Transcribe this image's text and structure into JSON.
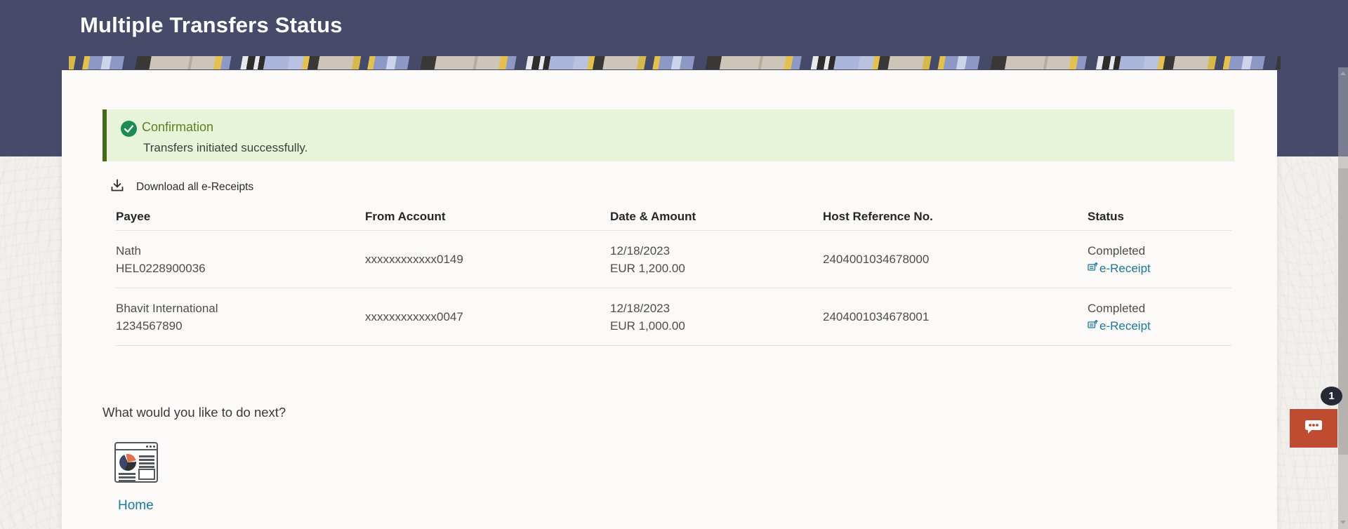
{
  "header": {
    "title": "Multiple Transfers Status"
  },
  "confirmation": {
    "title": "Confirmation",
    "message": "Transfers initiated successfully."
  },
  "actions": {
    "download_all_label": "Download all e-Receipts"
  },
  "table": {
    "columns": [
      "Payee",
      "From Account",
      "Date & Amount",
      "Host Reference No.",
      "Status"
    ],
    "rows": [
      {
        "payee_name": "Nath",
        "payee_id": "HEL0228900036",
        "from_account": "xxxxxxxxxxxx0149",
        "date": "12/18/2023",
        "amount": "EUR 1,200.00",
        "host_reference_no": "2404001034678000",
        "status": "Completed",
        "receipt_link": "e-Receipt"
      },
      {
        "payee_name": "Bhavit International",
        "payee_id": "1234567890",
        "from_account": "xxxxxxxxxxxx0047",
        "date": "12/18/2023",
        "amount": "EUR 1,000.00",
        "host_reference_no": "2404001034678001",
        "status": "Completed",
        "receipt_link": "e-Receipt"
      }
    ]
  },
  "next_section": {
    "prompt": "What would you like to do next?",
    "home_label": "Home"
  },
  "chat": {
    "badge_count": "1"
  },
  "icons": {
    "success": "check-circle-icon",
    "download": "download-tray-icon",
    "receipt": "e-receipt-export-icon",
    "home": "dashboard-page-icon",
    "chat": "chat-bubble-icon"
  },
  "colors": {
    "header_bg": "#474b69",
    "page_bg": "#f2f0ed",
    "card_bg": "#fbfaf9",
    "success_bg": "#e7f4da",
    "success_border": "#44691c",
    "success_check": "#1b8d52",
    "success_title_text": "#5d7f1f",
    "link_teal": "#1f7795",
    "chat_red": "#bf4b30",
    "chat_badge_bg": "#272935"
  }
}
